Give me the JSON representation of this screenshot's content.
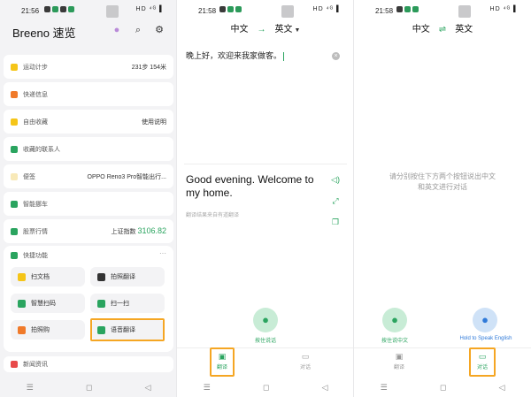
{
  "screen1": {
    "status": {
      "time": "21:56",
      "right": "HD ⁴ᴳ ▌"
    },
    "app_title": "Breeno 速览",
    "rows": [
      {
        "label": "运动计步",
        "value": "231步 154米",
        "color": "#f5c518"
      },
      {
        "label": "快递信息",
        "value": "",
        "color": "#f07a2a"
      },
      {
        "label": "自由收藏",
        "value": "使用说明",
        "color": "#f5c518"
      },
      {
        "label": "收藏的联系人",
        "value": "",
        "color": "#2aa45f"
      },
      {
        "label": "便签",
        "value": "OPPO Reno3 Pro智能出行...",
        "color": "#f8e9b8"
      },
      {
        "label": "智能挪车",
        "value": "",
        "color": "#2aa45f"
      },
      {
        "label": "股票行情",
        "value_label": "上证指数",
        "value_num": "3106.82",
        "color": "#2aa45f"
      }
    ],
    "quick": {
      "title": "快捷功能",
      "items": [
        {
          "label": "扫文档",
          "color": "#f5c518"
        },
        {
          "label": "拍照翻译",
          "color": "#333333"
        },
        {
          "label": "智慧扫码",
          "color": "#2aa45f"
        },
        {
          "label": "扫一扫",
          "color": "#2aa45f"
        },
        {
          "label": "拍照购",
          "color": "#f07a2a"
        },
        {
          "label": "语音翻译",
          "color": "#2aa45f"
        }
      ]
    },
    "news": "新闻资讯",
    "nav": [
      "☰",
      "◻",
      "◁"
    ]
  },
  "screen2": {
    "status": {
      "time": "21:58",
      "right": "HD ⁴ᴳ ▌"
    },
    "lang_from": "中文",
    "lang_to": "英文",
    "source_text": "晚上好，欢迎来我家做客。",
    "translated_text": "Good evening. Welcome to my home.",
    "note": "翻译结果来自有道翻译",
    "mic_label": "按住说话",
    "tabs": [
      {
        "label": "翻译"
      },
      {
        "label": "对话"
      }
    ],
    "nav": [
      "☰",
      "◻",
      "◁"
    ]
  },
  "screen3": {
    "status": {
      "time": "21:58",
      "right": "HD ⁴ᴳ ▌"
    },
    "lang_left": "中文",
    "lang_right": "英文",
    "hint": "请分别按住下方两个按钮说出中文和英文进行对话",
    "mic_left_label": "按住说中文",
    "mic_right_label": "Hold to Speak English",
    "tabs": [
      {
        "label": "翻译"
      },
      {
        "label": "对话"
      }
    ],
    "nav": [
      "☰",
      "◻",
      "◁"
    ]
  }
}
